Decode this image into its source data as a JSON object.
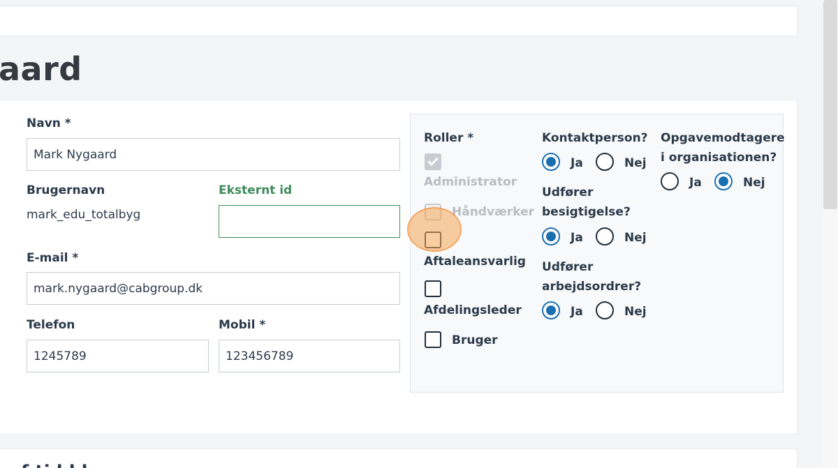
{
  "page": {
    "title": "aard"
  },
  "form": {
    "name_label": "Navn *",
    "name_value": "Mark Nygaard",
    "username_label": "Brugernavn",
    "username_value": "mark_edu_totalbyg",
    "external_id_label": "Eksternt id",
    "external_id_value": "",
    "email_label": "E-mail *",
    "email_value": "mark.nygaard@cabgroup.dk",
    "phone_label": "Telefon",
    "phone_value": "1245789",
    "mobile_label": "Mobil *",
    "mobile_value": "123456789"
  },
  "roles": {
    "heading": "Roller *",
    "items": [
      {
        "label": "Administrator",
        "checked": true,
        "disabled": true
      },
      {
        "label": "Håndværker",
        "checked": false,
        "disabled": true
      },
      {
        "label": "Aftaleansvarlig",
        "checked": false,
        "disabled": false
      },
      {
        "label": "Afdelingsleder",
        "checked": false,
        "disabled": false
      },
      {
        "label": "Bruger",
        "checked": false,
        "disabled": false
      }
    ]
  },
  "questions": {
    "contact": {
      "label": "Kontaktperson?",
      "yes": "Ja",
      "no": "Nej",
      "selected": "Ja"
    },
    "inspection": {
      "label_line1": "Udfører",
      "label_line2": "besigtigelse?",
      "yes": "Ja",
      "no": "Nej",
      "selected": "Ja"
    },
    "workorders": {
      "label_line1": "Udfører",
      "label_line2": "arbejdsordrer?",
      "yes": "Ja",
      "no": "Nej",
      "selected": "Ja"
    },
    "task_recipients": {
      "label_line1": "Opgavemodtagere",
      "label_line2": "i organisationen?",
      "yes": "Ja",
      "no": "Nej",
      "selected": "Nej"
    }
  },
  "section2": {
    "title_partial": "f     ti   l      l    l"
  },
  "colors": {
    "accent": "#1a6fb0",
    "green": "#3f8b5c",
    "click_highlight": "#f5a656"
  }
}
